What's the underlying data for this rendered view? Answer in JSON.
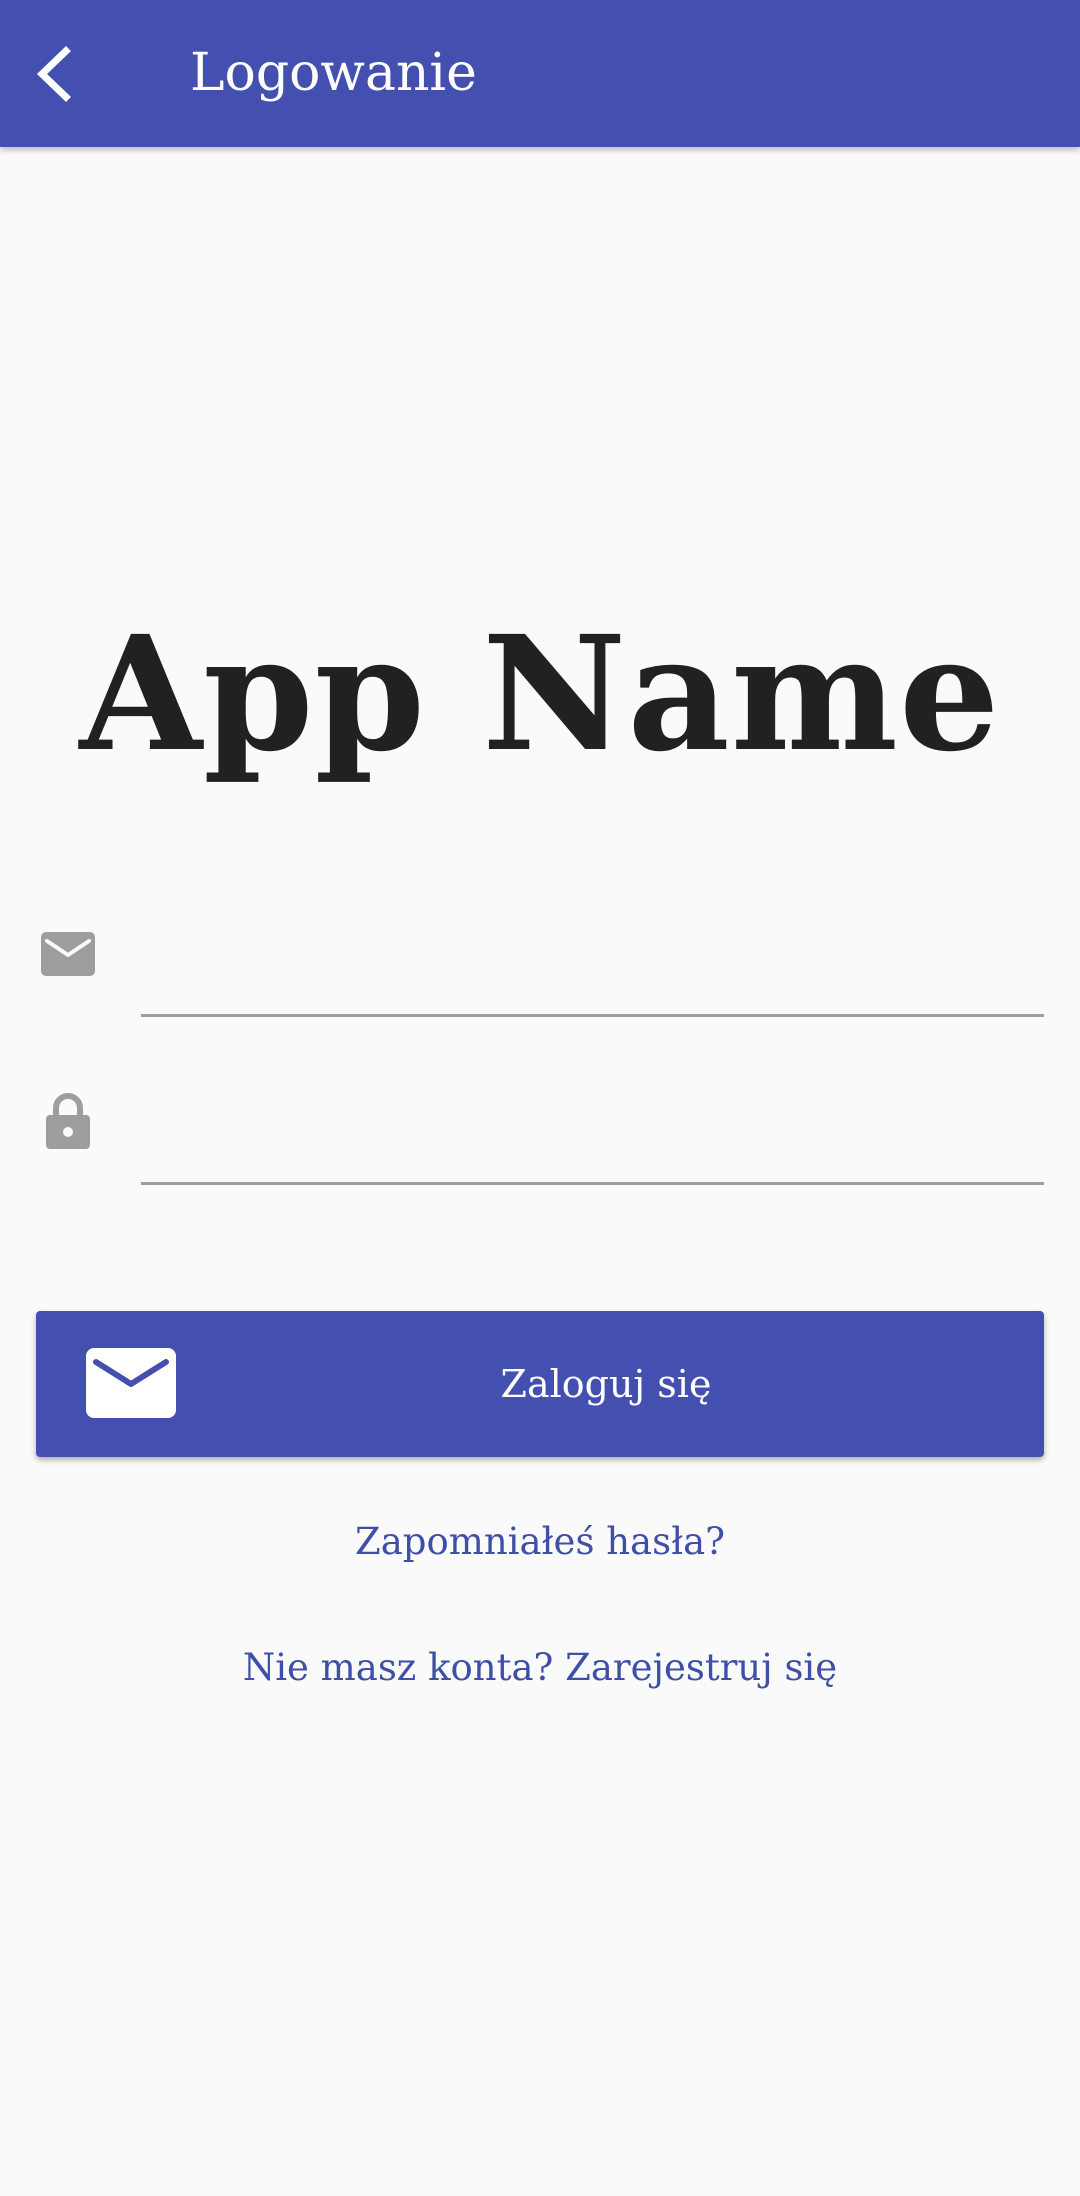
{
  "app_bar": {
    "title": "Logowanie",
    "back_icon": "arrow-back-icon",
    "background": "#4450b0"
  },
  "brand": {
    "app_name": "App Name"
  },
  "form": {
    "email": {
      "icon": "envelope-icon",
      "value": "",
      "placeholder": ""
    },
    "password": {
      "icon": "lock-icon",
      "value": "",
      "placeholder": ""
    }
  },
  "login_button": {
    "label": "Zaloguj się",
    "icon": "envelope-icon",
    "color": "#4450b0"
  },
  "links": {
    "forgot_password": "Zapomniałeś hasła?",
    "register": "Nie masz konta? Zarejestruj się"
  }
}
